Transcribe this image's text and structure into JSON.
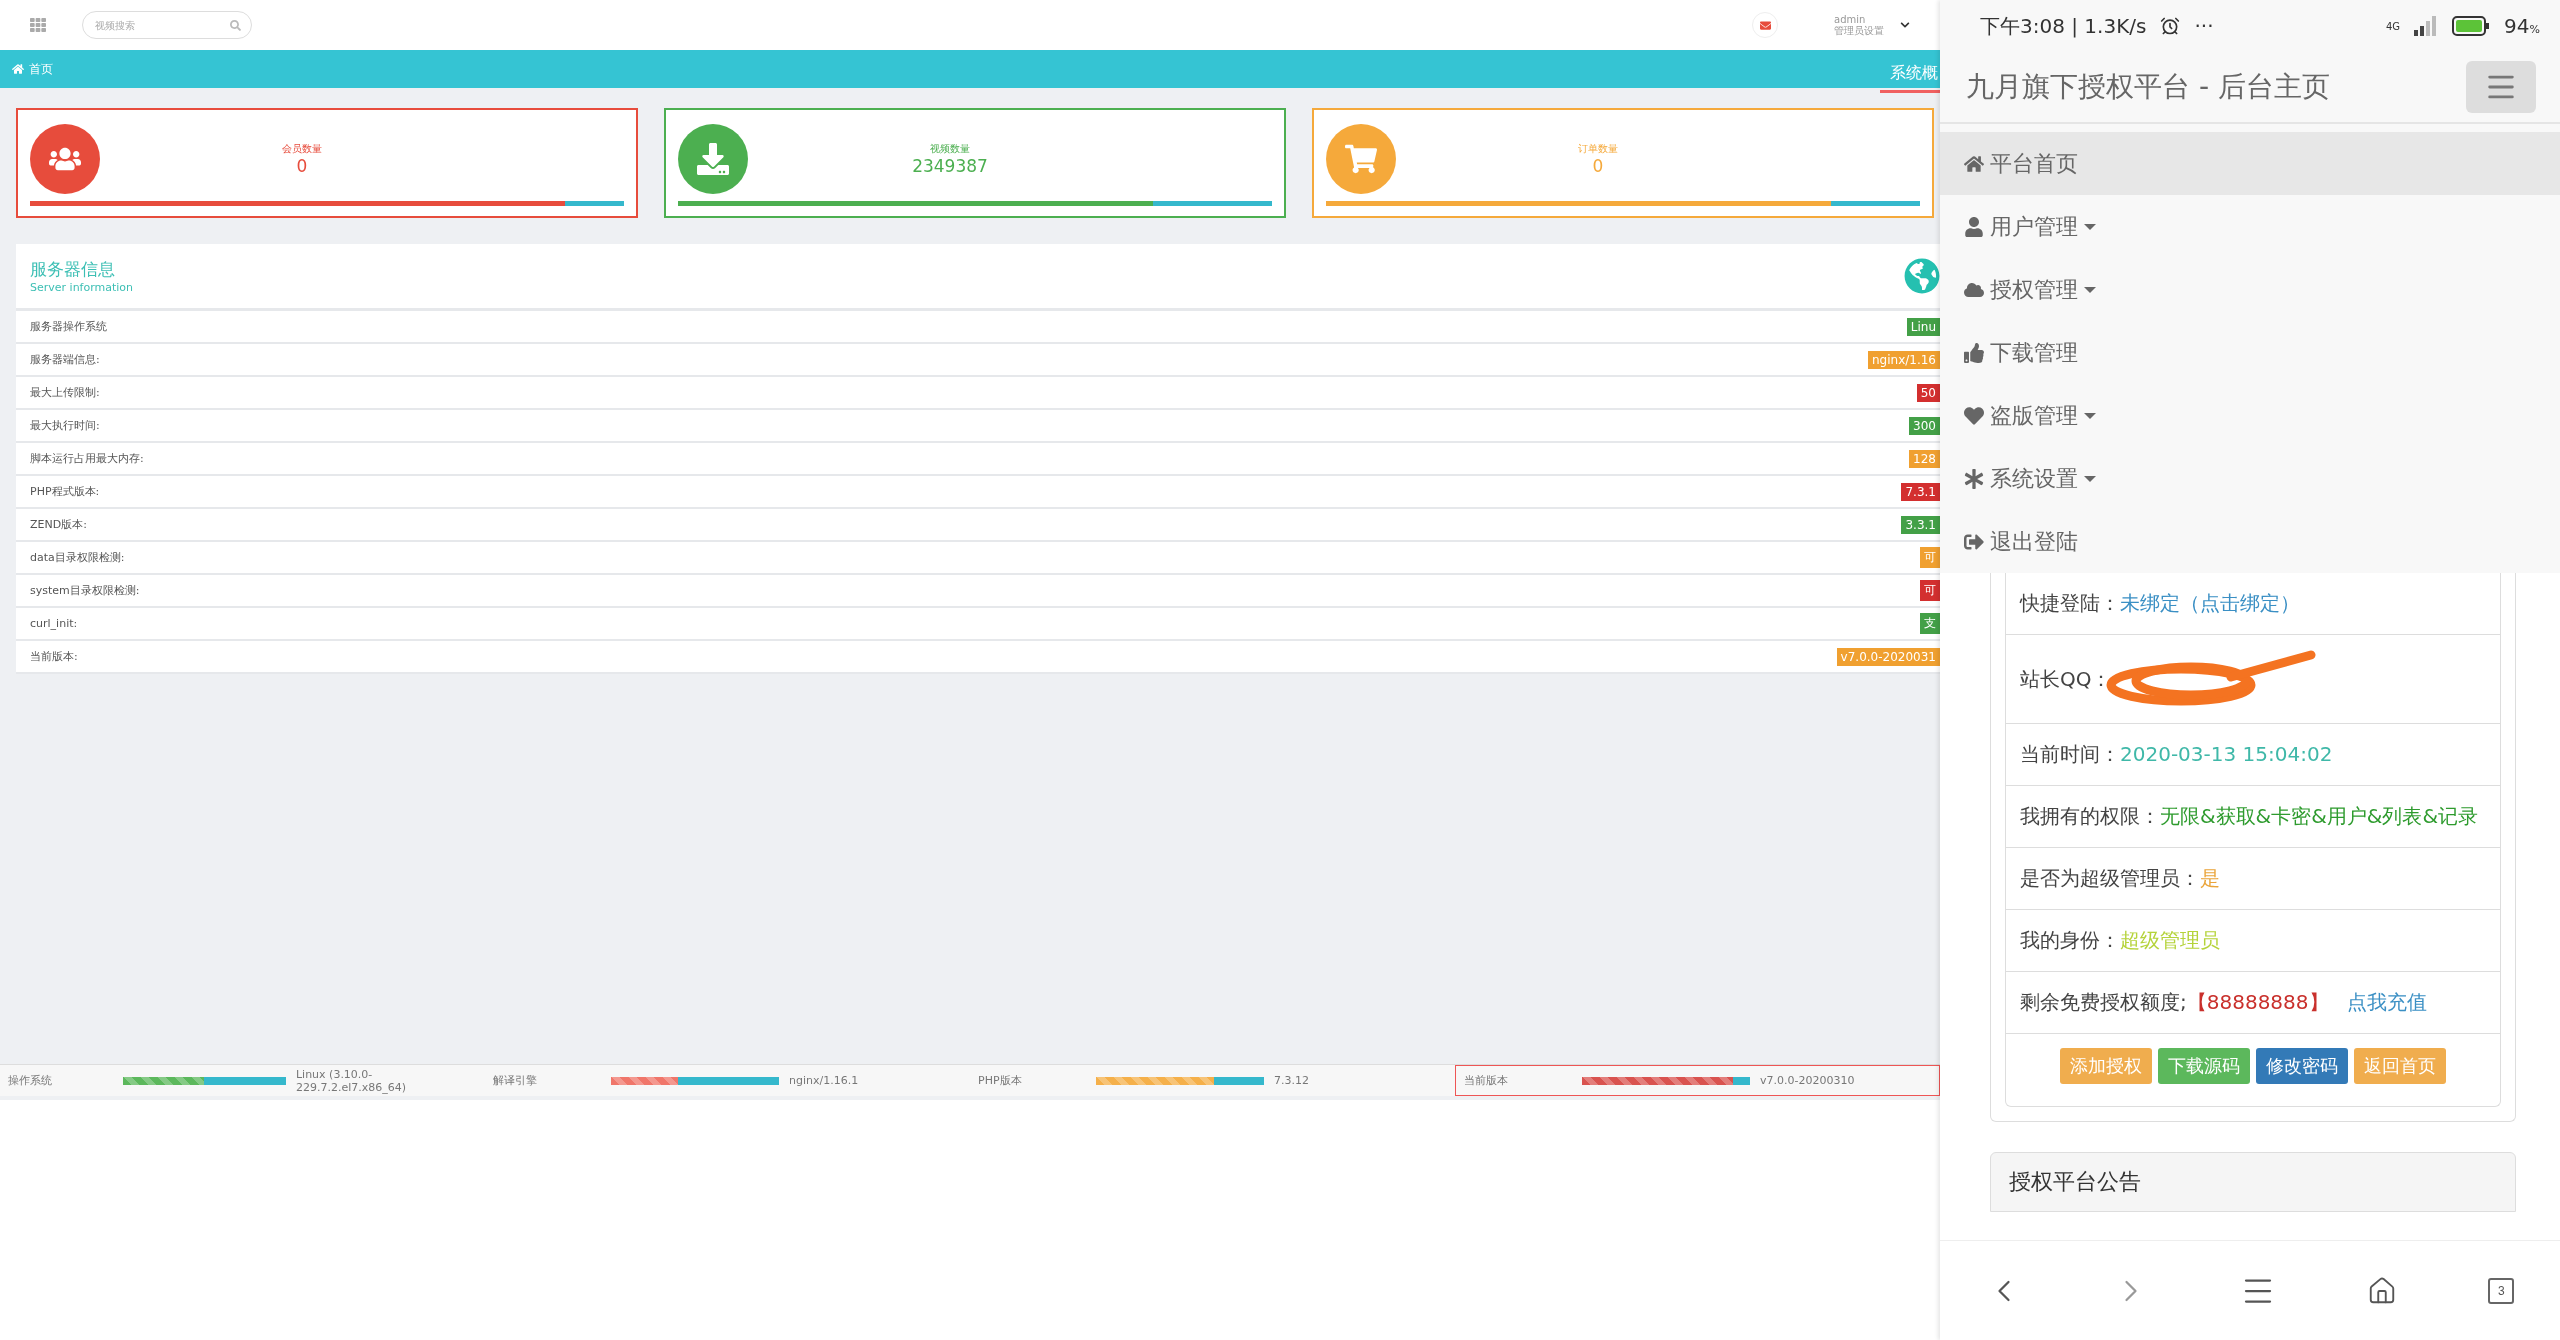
{
  "desktop": {
    "top_bar": {
      "search": {
        "placeholder": "视频搜索"
      },
      "user": {
        "name": "admin",
        "role": "管理员设置"
      }
    },
    "breadcrumb": {
      "home": "首页",
      "title": "系统概"
    },
    "stats": [
      {
        "label": "会员数量",
        "value": "0",
        "color": "#e74c3c",
        "level": 0.9
      },
      {
        "label": "视频数量",
        "value": "2349387",
        "color": "#4caf50",
        "level": 0.8
      },
      {
        "label": "订单数量",
        "value": "0",
        "color": "#f5a93b",
        "level": 0.85
      }
    ],
    "server_info": {
      "title": "服务器信息",
      "subtitle": "Server information",
      "rows": [
        {
          "label": "服务器操作系统",
          "badge": "Linu",
          "color": "#43a047"
        },
        {
          "label": "服务器端信息:",
          "badge": "nginx/1.16",
          "color": "#f0a030"
        },
        {
          "label": "最大上传限制:",
          "badge": "50",
          "color": "#d32f2f"
        },
        {
          "label": "最大执行时间:",
          "badge": "300",
          "color": "#43a047"
        },
        {
          "label": "脚本运行占用最大内存:",
          "badge": "128",
          "color": "#f0a030"
        },
        {
          "label": "PHP程式版本:",
          "badge": "7.3.1",
          "color": "#d32f2f"
        },
        {
          "label": "ZEND版本:",
          "badge": "3.3.1",
          "color": "#43a047"
        },
        {
          "label": "data目录权限检测:",
          "badge": "可",
          "color": "#f0a030"
        },
        {
          "label": "system目录权限检测:",
          "badge": "可",
          "color": "#d32f2f"
        },
        {
          "label": "curl_init:",
          "badge": "支",
          "color": "#43a047"
        },
        {
          "label": "当前版本:",
          "badge": "v7.0.0-2020031",
          "color": "#f0a030"
        }
      ]
    },
    "status_bar": [
      {
        "label": "操作系统",
        "value": "Linux (3.10.0-229.7.2.el7.x86_64)",
        "color": "#5cb85c",
        "level": 0.5,
        "highlighted": false
      },
      {
        "label": "解译引擎",
        "value": "nginx/1.16.1",
        "color": "#f0766a",
        "level": 0.4,
        "highlighted": false
      },
      {
        "label": "PHP版本",
        "value": "7.3.12",
        "color": "#f5b04a",
        "level": 0.7,
        "highlighted": false
      },
      {
        "label": "当前版本",
        "value": "v7.0.0-20200310",
        "color": "#d9534f",
        "level": 0.9,
        "highlighted": true
      }
    ]
  },
  "phone": {
    "status_bar": {
      "time": "下午3:08 | 1.3K/s",
      "more": "···",
      "network": "4G",
      "battery": "94",
      "percent": "%"
    },
    "header": {
      "title": "九月旗下授权平台 - 后台主页"
    },
    "menu": [
      {
        "label": "平台首页",
        "selected": true,
        "has_caret": false
      },
      {
        "label": "用户管理",
        "selected": false,
        "has_caret": true
      },
      {
        "label": "授权管理",
        "selected": false,
        "has_caret": true
      },
      {
        "label": "下载管理",
        "selected": false,
        "has_caret": false
      },
      {
        "label": "盗版管理",
        "selected": false,
        "has_caret": true
      },
      {
        "label": "系统设置",
        "selected": false,
        "has_caret": true
      },
      {
        "label": "退出登陆",
        "selected": false,
        "has_caret": false
      }
    ],
    "info_rows": [
      {
        "label": "快捷登陆：",
        "value": "未绑定（点击绑定）",
        "color": "#3a8fc4",
        "redacted": false
      },
      {
        "label": "站长QQ：",
        "redacted": true
      },
      {
        "label": "当前时间：",
        "value": "2020-03-13 15:04:02",
        "color": "#3fb8a8",
        "redacted": false
      },
      {
        "label": "我拥有的权限：",
        "value": "无限&获取&卡密&用户&列表&记录",
        "color": "#2e9b2e",
        "redacted": false
      },
      {
        "label": "是否为超级管理员：",
        "value": "是",
        "color": "#eaa43a",
        "redacted": false
      },
      {
        "label": "我的身份：",
        "value": "超级管理员",
        "color": "#b5d33a",
        "redacted": false
      },
      {
        "label": "剩余免费授权额度;",
        "value": "【88888888】",
        "color": "#c9302c",
        "link": "点我充值",
        "redacted": false
      }
    ],
    "buttons": [
      {
        "label": "添加授权",
        "color": "#f0ad4e"
      },
      {
        "label": "下载源码",
        "color": "#5cb85c"
      },
      {
        "label": "修改密码",
        "color": "#337ab7"
      },
      {
        "label": "返回首页",
        "color": "#f0ad4e"
      }
    ],
    "announcement": {
      "title": "授权平台公告"
    },
    "nav_bar": {
      "tabs": "3"
    }
  }
}
